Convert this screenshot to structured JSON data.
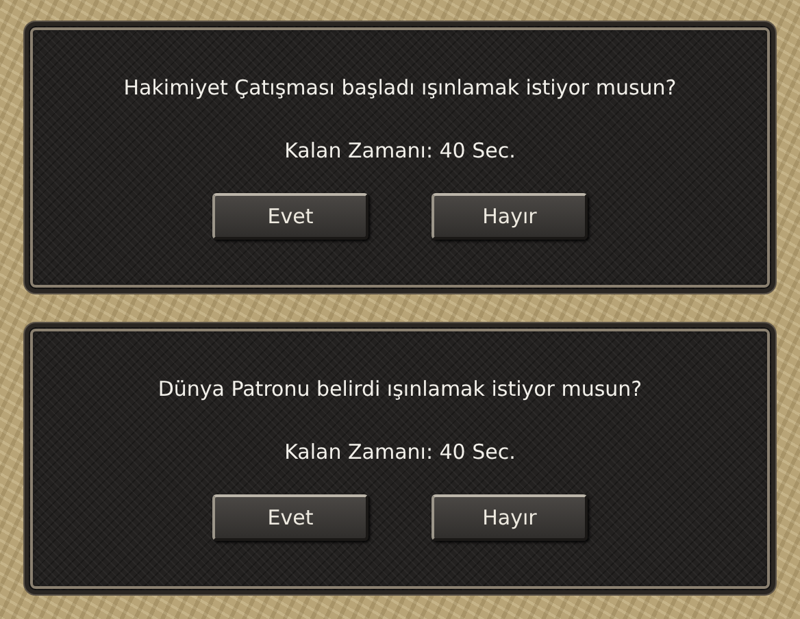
{
  "dialogs": [
    {
      "message": "Hakimiyet Çatışması başladı ışınlamak istiyor musun?",
      "time": "Kalan Zamanı: 40 Sec.",
      "buttons": [
        "Evet",
        "Hayır"
      ]
    },
    {
      "message": "Dünya Patronu belirdi ışınlamak istiyor musun?",
      "time": "Kalan Zamanı: 40 Sec.",
      "buttons": [
        "Evet",
        "Hayır"
      ]
    }
  ]
}
